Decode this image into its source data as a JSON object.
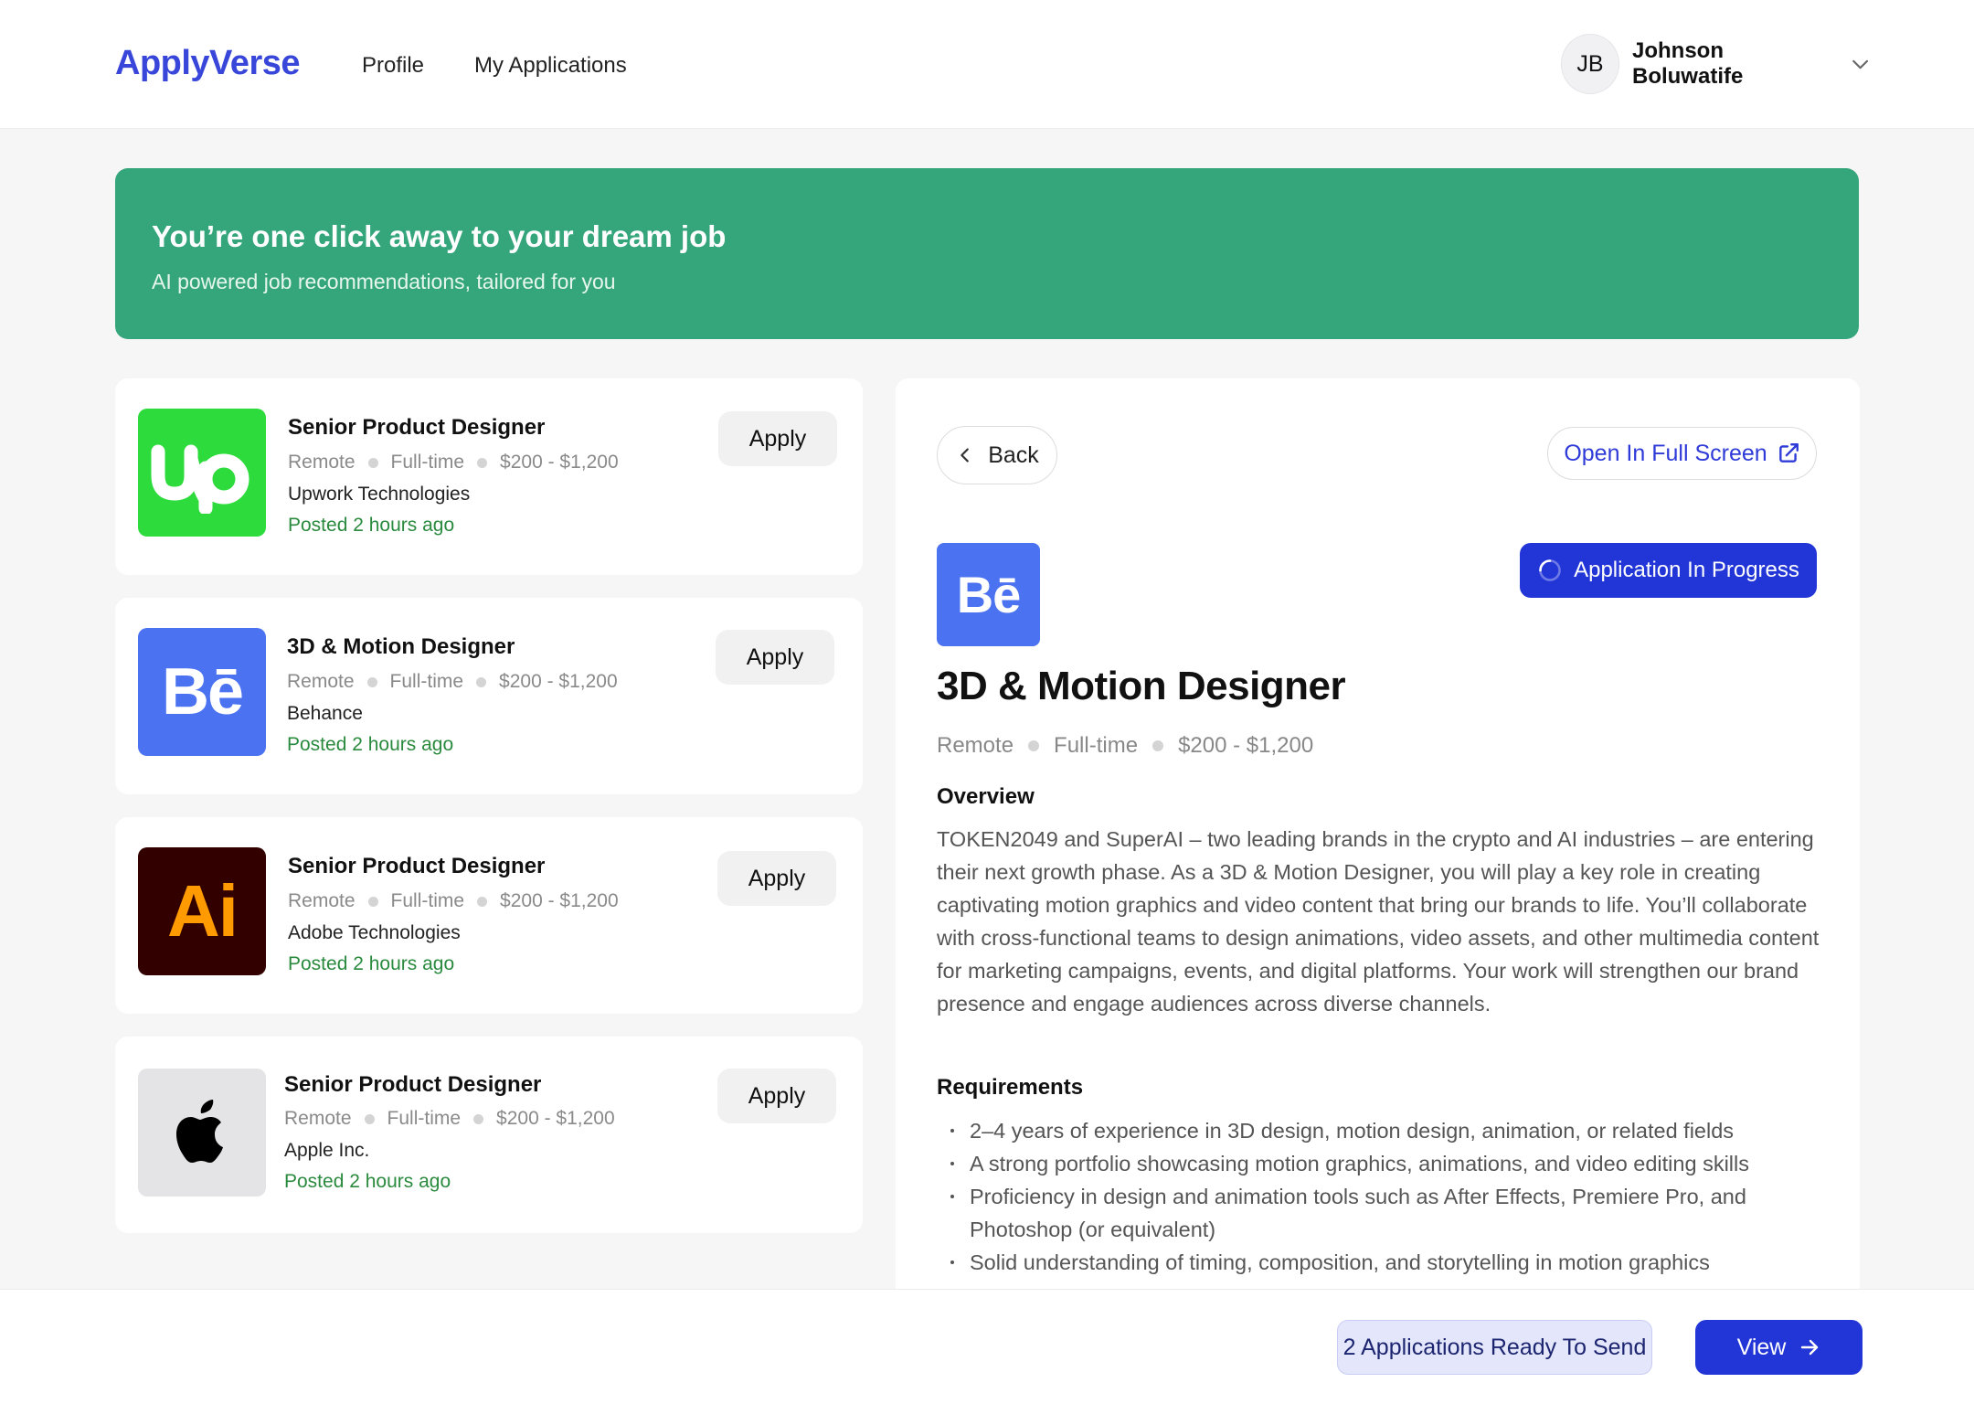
{
  "app": {
    "brand": "ApplyVerse"
  },
  "nav": {
    "profile": "Profile",
    "applications": "My Applications"
  },
  "user": {
    "initials": "JB",
    "name": "Johnson Boluwatife"
  },
  "hero": {
    "title": "You’re one click away to your dream job",
    "subtitle": "AI powered job recommendations, tailored for you"
  },
  "jobs": [
    {
      "title": "Senior Product Designer",
      "location": "Remote",
      "type": "Full-time",
      "salary": "$200 - $1,200",
      "company": "Upwork Technologies",
      "posted": "Posted 2 hours ago",
      "apply": "Apply",
      "logo_icon": "upwork-logo-icon",
      "logo_bg": "#2ddc3c"
    },
    {
      "title": "3D & Motion Designer",
      "location": "Remote",
      "type": "Full-time",
      "salary": "$200 - $1,200",
      "company": "Behance",
      "posted": "Posted 2 hours ago",
      "apply": "Apply",
      "logo_icon": "behance-logo-icon",
      "logo_bg": "#4b72f0",
      "logo_text": "Bē"
    },
    {
      "title": "Senior Product Designer",
      "location": "Remote",
      "type": "Full-time",
      "salary": "$200 - $1,200",
      "company": "Adobe Technologies",
      "posted": "Posted 2 hours ago",
      "apply": "Apply",
      "logo_icon": "adobe-illustrator-logo-icon",
      "logo_bg": "#330000",
      "logo_text": "Ai"
    },
    {
      "title": "Senior Product Designer",
      "location": "Remote",
      "type": "Full-time",
      "salary": "$200 - $1,200",
      "company": "Apple Inc.",
      "posted": "Posted 2 hours ago",
      "apply": "Apply",
      "logo_icon": "apple-logo-icon",
      "logo_bg": "#e4e4e6"
    }
  ],
  "detail": {
    "back": "Back",
    "fullscreen": "Open In Full Screen",
    "status": "Application In Progress",
    "logo_text": "Bē",
    "title": "3D & Motion Designer",
    "location": "Remote",
    "type": "Full-time",
    "salary": "$200 - $1,200",
    "overview_heading": "Overview",
    "overview": "TOKEN2049 and SuperAI – two leading brands in the crypto and AI industries – are entering their next growth phase. As a 3D & Motion Designer, you will play a key role in creating captivating motion graphics and video content that bring our brands to life. You’ll collaborate with cross-functional teams to design animations, video assets, and other multimedia content for marketing campaigns, events, and digital platforms. Your work will strengthen our brand presence and engage audiences across diverse channels.",
    "requirements_heading": "Requirements",
    "requirements": [
      "2–4 years of experience in 3D design, motion design, animation, or related fields",
      "A strong portfolio showcasing motion graphics, animations, and video editing skills",
      "Proficiency in design and animation tools such as After Effects, Premiere Pro, and Photoshop (or equivalent)",
      "Solid understanding of timing, composition, and storytelling in motion graphics"
    ]
  },
  "footer": {
    "ready": "2 Applications Ready To Send",
    "view": "View"
  },
  "colors": {
    "brand": "#3846d9",
    "hero": "#35a67c",
    "primary": "#2235d6",
    "posted": "#2a8a3e"
  }
}
